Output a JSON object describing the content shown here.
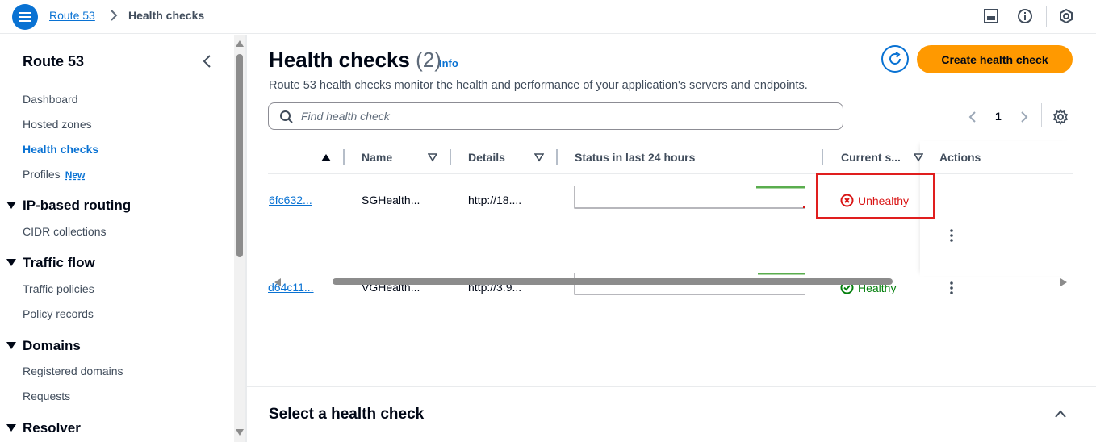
{
  "topbar": {
    "breadcrumb_root": "Route 53",
    "breadcrumb_current": "Health checks"
  },
  "sidebar": {
    "title": "Route 53",
    "links": [
      {
        "label": "Dashboard"
      },
      {
        "label": "Hosted zones"
      },
      {
        "label": "Health checks",
        "active": true
      },
      {
        "label": "Profiles",
        "badge": "New"
      }
    ],
    "sections": [
      {
        "title": "IP-based routing",
        "items": [
          "CIDR collections"
        ]
      },
      {
        "title": "Traffic flow",
        "items": [
          "Traffic policies",
          "Policy records"
        ]
      },
      {
        "title": "Domains",
        "items": [
          "Registered domains",
          "Requests"
        ]
      },
      {
        "title": "Resolver",
        "items": []
      }
    ]
  },
  "main": {
    "title": "Health checks",
    "count": "(2)",
    "info_label": "Info",
    "description": "Route 53 health checks monitor the health and performance of your application's servers and endpoints.",
    "create_button": "Create health check",
    "search_placeholder": "Find health check",
    "pagination": {
      "current_page": "1"
    },
    "table": {
      "columns": [
        "Name",
        "Details",
        "Status in last 24 hours",
        "Current s...",
        "Actions"
      ],
      "rows": [
        {
          "id": "6fc632...",
          "name": "SGHealth...",
          "details": "http://18....",
          "status": "Unhealthy",
          "status_color": "#d91515"
        },
        {
          "id": "d64c11...",
          "name": "VGHealth...",
          "details": "http://3.9...",
          "status": "Healthy",
          "status_color": "#037f0c"
        }
      ]
    },
    "bottom_panel_title": "Select a health check"
  },
  "colors": {
    "accent": "#0972d3",
    "primary_button": "#ff9900",
    "unhealthy": "#d91515",
    "healthy": "#037f0c",
    "highlight_box": "#e01e1e"
  }
}
